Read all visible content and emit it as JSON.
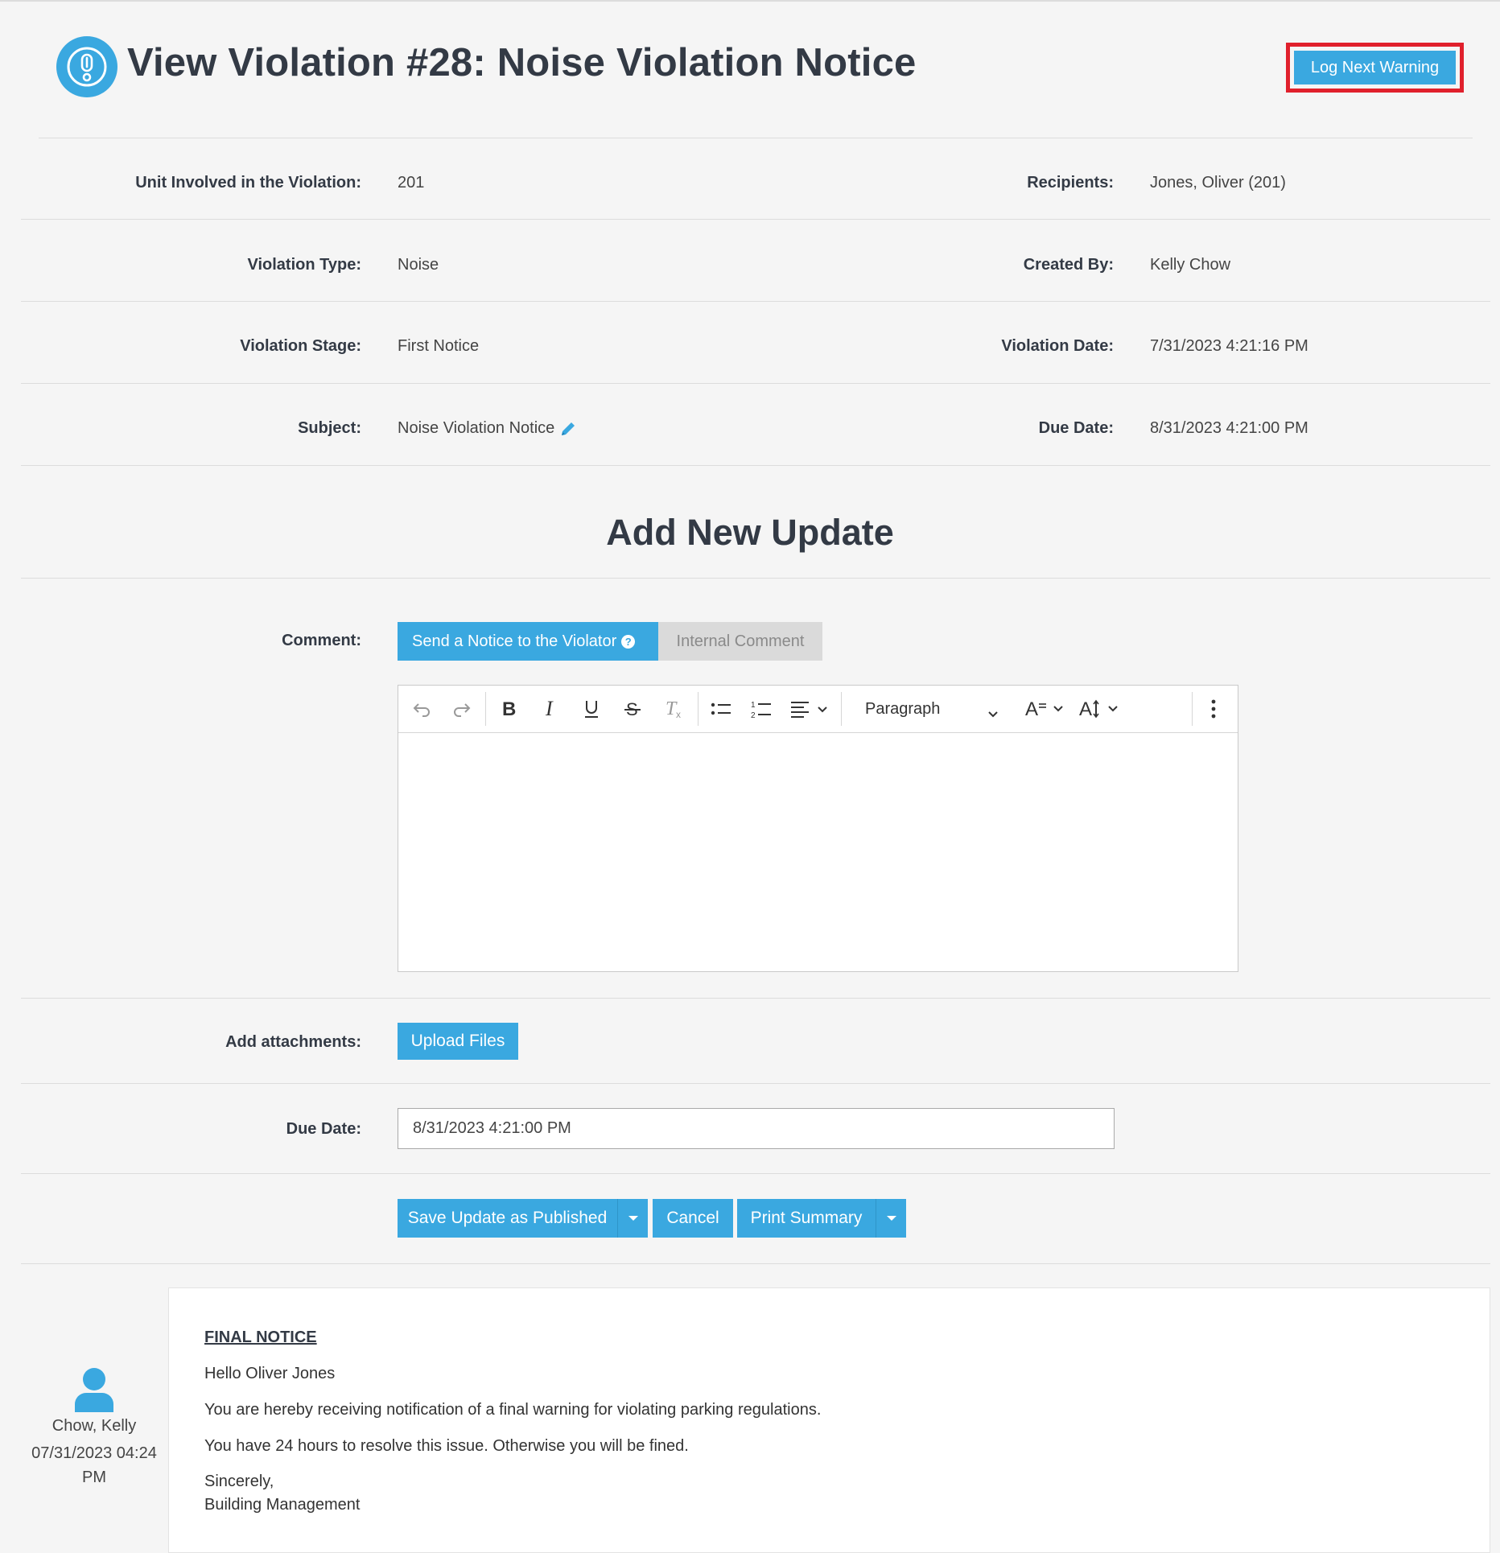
{
  "header": {
    "title": "View Violation #28: Noise Violation Notice",
    "log_next_warning": "Log Next Warning"
  },
  "details": {
    "unit_label": "Unit Involved in the Violation:",
    "unit_value": "201",
    "recipients_label": "Recipients:",
    "recipients_value": "Jones, Oliver (201)",
    "type_label": "Violation Type:",
    "type_value": "Noise",
    "created_by_label": "Created By:",
    "created_by_value": "Kelly Chow",
    "stage_label": "Violation Stage:",
    "stage_value": "First Notice",
    "violation_date_label": "Violation Date:",
    "violation_date_value": "7/31/2023 4:21:16 PM",
    "subject_label": "Subject:",
    "subject_value": "Noise Violation Notice",
    "due_date_label": "Due Date:",
    "due_date_value": "8/31/2023 4:21:00 PM"
  },
  "update_form": {
    "section_title": "Add New Update",
    "comment_label": "Comment:",
    "tab_notice": "Send a Notice to the Violator",
    "tab_internal": "Internal Comment",
    "paragraph_style": "Paragraph",
    "attachments_label": "Add attachments:",
    "upload_button": "Upload Files",
    "due_date_label": "Due Date:",
    "due_date_value": "8/31/2023 4:21:00 PM",
    "save_button": "Save Update as Published",
    "cancel_button": "Cancel",
    "print_button": "Print Summary"
  },
  "update_history": [
    {
      "author": "Chow, Kelly",
      "timestamp": "07/31/2023 04:24 PM",
      "heading": "FINAL NOTICE",
      "greeting": "Hello Oliver Jones",
      "line1": "You are hereby receiving notification of a final warning for violating parking regulations.",
      "line2": "You have 24 hours to resolve this issue. Otherwise you will be fined.",
      "closing": "Sincerely,",
      "signature": "Building Management"
    }
  ],
  "colors": {
    "accent": "#3aa8e0",
    "highlight_border": "#e0202c",
    "background": "#f5f5f5"
  }
}
